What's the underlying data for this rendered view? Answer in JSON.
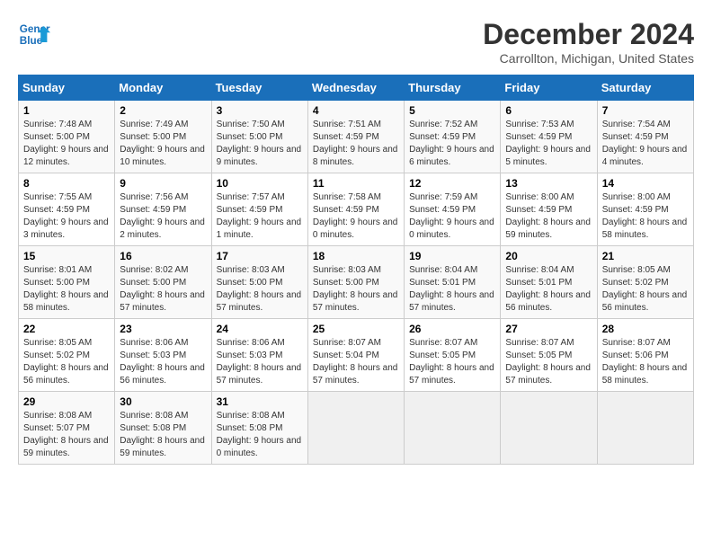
{
  "header": {
    "logo_line1": "General",
    "logo_line2": "Blue",
    "title": "December 2024",
    "subtitle": "Carrollton, Michigan, United States"
  },
  "weekdays": [
    "Sunday",
    "Monday",
    "Tuesday",
    "Wednesday",
    "Thursday",
    "Friday",
    "Saturday"
  ],
  "weeks": [
    [
      {
        "day": "1",
        "sunrise": "7:48 AM",
        "sunset": "5:00 PM",
        "daylight": "9 hours and 12 minutes."
      },
      {
        "day": "2",
        "sunrise": "7:49 AM",
        "sunset": "5:00 PM",
        "daylight": "9 hours and 10 minutes."
      },
      {
        "day": "3",
        "sunrise": "7:50 AM",
        "sunset": "5:00 PM",
        "daylight": "9 hours and 9 minutes."
      },
      {
        "day": "4",
        "sunrise": "7:51 AM",
        "sunset": "4:59 PM",
        "daylight": "9 hours and 8 minutes."
      },
      {
        "day": "5",
        "sunrise": "7:52 AM",
        "sunset": "4:59 PM",
        "daylight": "9 hours and 6 minutes."
      },
      {
        "day": "6",
        "sunrise": "7:53 AM",
        "sunset": "4:59 PM",
        "daylight": "9 hours and 5 minutes."
      },
      {
        "day": "7",
        "sunrise": "7:54 AM",
        "sunset": "4:59 PM",
        "daylight": "9 hours and 4 minutes."
      }
    ],
    [
      {
        "day": "8",
        "sunrise": "7:55 AM",
        "sunset": "4:59 PM",
        "daylight": "9 hours and 3 minutes."
      },
      {
        "day": "9",
        "sunrise": "7:56 AM",
        "sunset": "4:59 PM",
        "daylight": "9 hours and 2 minutes."
      },
      {
        "day": "10",
        "sunrise": "7:57 AM",
        "sunset": "4:59 PM",
        "daylight": "9 hours and 1 minute."
      },
      {
        "day": "11",
        "sunrise": "7:58 AM",
        "sunset": "4:59 PM",
        "daylight": "9 hours and 0 minutes."
      },
      {
        "day": "12",
        "sunrise": "7:59 AM",
        "sunset": "4:59 PM",
        "daylight": "9 hours and 0 minutes."
      },
      {
        "day": "13",
        "sunrise": "8:00 AM",
        "sunset": "4:59 PM",
        "daylight": "8 hours and 59 minutes."
      },
      {
        "day": "14",
        "sunrise": "8:00 AM",
        "sunset": "4:59 PM",
        "daylight": "8 hours and 58 minutes."
      }
    ],
    [
      {
        "day": "15",
        "sunrise": "8:01 AM",
        "sunset": "5:00 PM",
        "daylight": "8 hours and 58 minutes."
      },
      {
        "day": "16",
        "sunrise": "8:02 AM",
        "sunset": "5:00 PM",
        "daylight": "8 hours and 57 minutes."
      },
      {
        "day": "17",
        "sunrise": "8:03 AM",
        "sunset": "5:00 PM",
        "daylight": "8 hours and 57 minutes."
      },
      {
        "day": "18",
        "sunrise": "8:03 AM",
        "sunset": "5:00 PM",
        "daylight": "8 hours and 57 minutes."
      },
      {
        "day": "19",
        "sunrise": "8:04 AM",
        "sunset": "5:01 PM",
        "daylight": "8 hours and 57 minutes."
      },
      {
        "day": "20",
        "sunrise": "8:04 AM",
        "sunset": "5:01 PM",
        "daylight": "8 hours and 56 minutes."
      },
      {
        "day": "21",
        "sunrise": "8:05 AM",
        "sunset": "5:02 PM",
        "daylight": "8 hours and 56 minutes."
      }
    ],
    [
      {
        "day": "22",
        "sunrise": "8:05 AM",
        "sunset": "5:02 PM",
        "daylight": "8 hours and 56 minutes."
      },
      {
        "day": "23",
        "sunrise": "8:06 AM",
        "sunset": "5:03 PM",
        "daylight": "8 hours and 56 minutes."
      },
      {
        "day": "24",
        "sunrise": "8:06 AM",
        "sunset": "5:03 PM",
        "daylight": "8 hours and 57 minutes."
      },
      {
        "day": "25",
        "sunrise": "8:07 AM",
        "sunset": "5:04 PM",
        "daylight": "8 hours and 57 minutes."
      },
      {
        "day": "26",
        "sunrise": "8:07 AM",
        "sunset": "5:05 PM",
        "daylight": "8 hours and 57 minutes."
      },
      {
        "day": "27",
        "sunrise": "8:07 AM",
        "sunset": "5:05 PM",
        "daylight": "8 hours and 57 minutes."
      },
      {
        "day": "28",
        "sunrise": "8:07 AM",
        "sunset": "5:06 PM",
        "daylight": "8 hours and 58 minutes."
      }
    ],
    [
      {
        "day": "29",
        "sunrise": "8:08 AM",
        "sunset": "5:07 PM",
        "daylight": "8 hours and 59 minutes."
      },
      {
        "day": "30",
        "sunrise": "8:08 AM",
        "sunset": "5:08 PM",
        "daylight": "8 hours and 59 minutes."
      },
      {
        "day": "31",
        "sunrise": "8:08 AM",
        "sunset": "5:08 PM",
        "daylight": "9 hours and 0 minutes."
      },
      null,
      null,
      null,
      null
    ]
  ],
  "labels": {
    "sunrise_prefix": "Sunrise: ",
    "sunset_prefix": "Sunset: ",
    "daylight_prefix": "Daylight: "
  }
}
